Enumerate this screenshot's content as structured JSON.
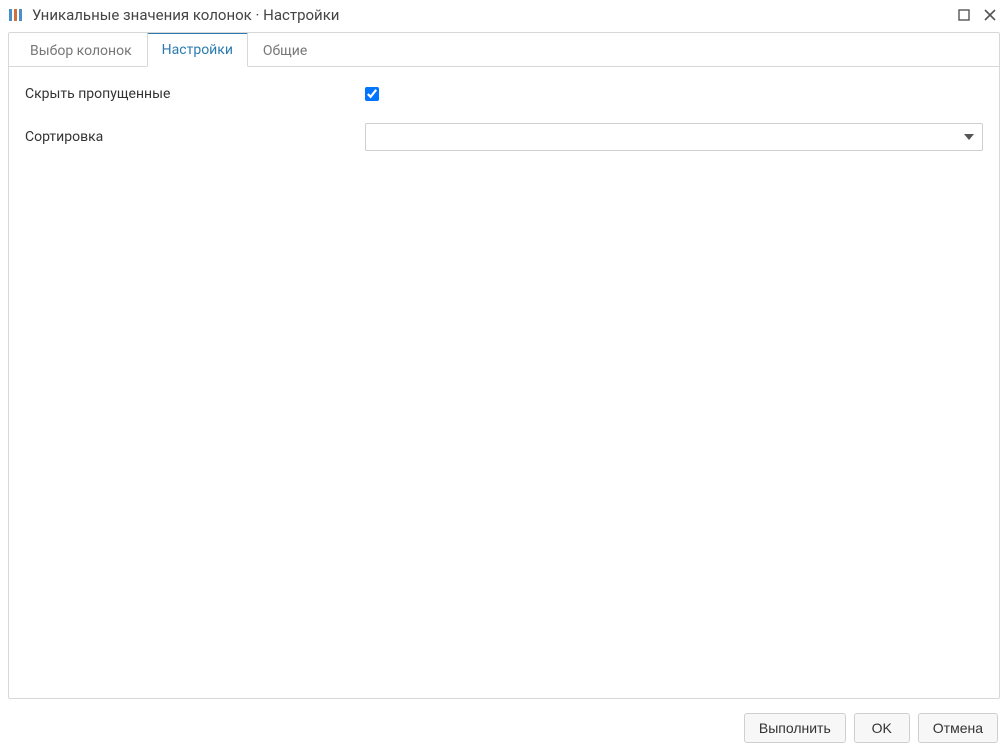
{
  "window": {
    "title": "Уникальные значения колонок · Настройки"
  },
  "tabs": [
    {
      "label": "Выбор колонок",
      "active": false
    },
    {
      "label": "Настройки",
      "active": true
    },
    {
      "label": "Общие",
      "active": false
    }
  ],
  "settings": {
    "hide_missing": {
      "label": "Скрыть пропущенные",
      "checked": true
    },
    "sort": {
      "label": "Сортировка",
      "value": ""
    }
  },
  "footer": {
    "execute": "Выполнить",
    "ok": "OK",
    "cancel": "Отмена"
  }
}
